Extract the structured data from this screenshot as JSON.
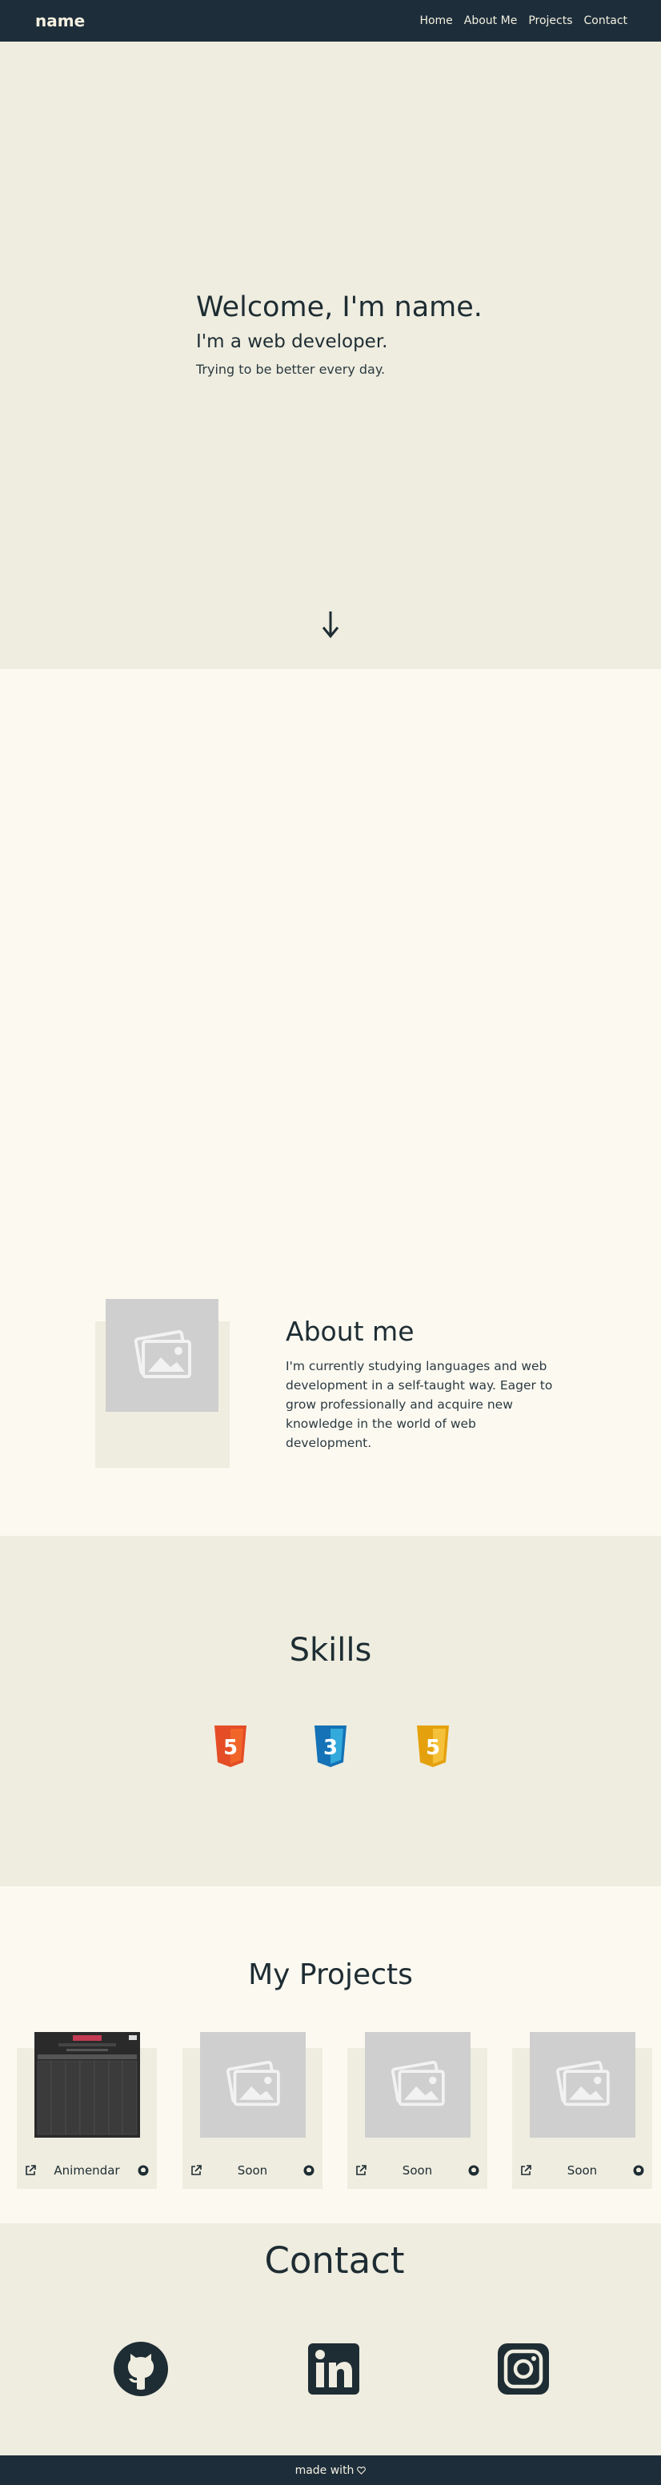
{
  "nav": {
    "brand": "name",
    "links": [
      "Home",
      "About Me",
      "Projects",
      "Contact"
    ]
  },
  "hero": {
    "title": "Welcome, I'm name.",
    "subtitle": "I'm a web developer.",
    "tagline": "Trying to be better every day.",
    "scroll_icon": "arrow-down-icon"
  },
  "about": {
    "title": "About me",
    "body": "I'm currently studying languages and web development in a self-taught way. Eager to grow professionally and acquire new knowledge in the world of web development.",
    "image_icon": "image-placeholder-icon"
  },
  "skills": {
    "title": "Skills",
    "items": [
      {
        "name": "html5-icon",
        "label": "5",
        "color": "#e44d26"
      },
      {
        "name": "css3-icon",
        "label": "3",
        "color": "#1572b6"
      },
      {
        "name": "javascript-icon",
        "label": "5",
        "color": "#f0a30a"
      }
    ]
  },
  "projects": {
    "title": "My Projects",
    "cards": [
      {
        "name": "Animendar",
        "image": "screenshot"
      },
      {
        "name": "Soon",
        "image": "placeholder"
      },
      {
        "name": "Soon",
        "image": "placeholder"
      },
      {
        "name": "Soon",
        "image": "placeholder"
      }
    ]
  },
  "contact": {
    "title": "Contact",
    "links": [
      "github-icon",
      "linkedin-icon",
      "instagram-icon"
    ]
  },
  "footer": {
    "text": "made with",
    "icon": "heart-icon"
  },
  "colors": {
    "navy": "#1e2d3a",
    "cream": "#efede0",
    "light_cream": "#fcf9f1",
    "placeholder": "#cfcfcf"
  }
}
